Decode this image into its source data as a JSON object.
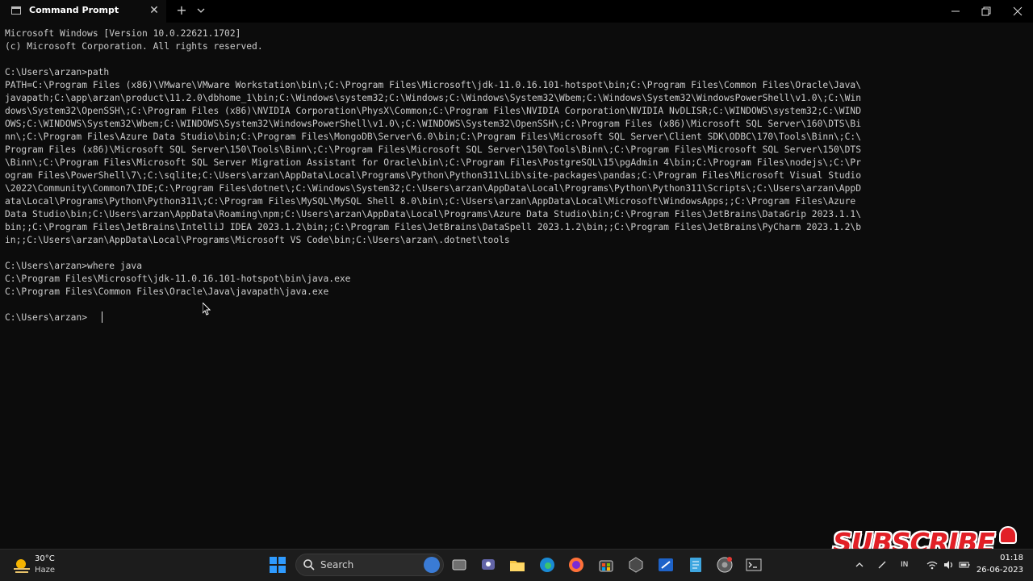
{
  "window": {
    "tab_title": "Command Prompt",
    "tab_close_glyph": "✕",
    "new_tab_glyph": "+"
  },
  "terminal": {
    "lines": [
      "Microsoft Windows [Version 10.0.22621.1702]",
      "(c) Microsoft Corporation. All rights reserved.",
      "",
      "C:\\Users\\arzan>path",
      "PATH=C:\\Program Files (x86)\\VMware\\VMware Workstation\\bin\\;C:\\Program Files\\Microsoft\\jdk-11.0.16.101-hotspot\\bin;C:\\Program Files\\Common Files\\Oracle\\Java\\",
      "javapath;C:\\app\\arzan\\product\\11.2.0\\dbhome_1\\bin;C:\\Windows\\system32;C:\\Windows;C:\\Windows\\System32\\Wbem;C:\\Windows\\System32\\WindowsPowerShell\\v1.0\\;C:\\Win",
      "dows\\System32\\OpenSSH\\;C:\\Program Files (x86)\\NVIDIA Corporation\\PhysX\\Common;C:\\Program Files\\NVIDIA Corporation\\NVIDIA NvDLISR;C:\\WINDOWS\\system32;C:\\WIND",
      "OWS;C:\\WINDOWS\\System32\\Wbem;C:\\WINDOWS\\System32\\WindowsPowerShell\\v1.0\\;C:\\WINDOWS\\System32\\OpenSSH\\;C:\\Program Files (x86)\\Microsoft SQL Server\\160\\DTS\\Bi",
      "nn\\;C:\\Program Files\\Azure Data Studio\\bin;C:\\Program Files\\MongoDB\\Server\\6.0\\bin;C:\\Program Files\\Microsoft SQL Server\\Client SDK\\ODBC\\170\\Tools\\Binn\\;C:\\",
      "Program Files (x86)\\Microsoft SQL Server\\150\\Tools\\Binn\\;C:\\Program Files\\Microsoft SQL Server\\150\\Tools\\Binn\\;C:\\Program Files\\Microsoft SQL Server\\150\\DTS",
      "\\Binn\\;C:\\Program Files\\Microsoft SQL Server Migration Assistant for Oracle\\bin\\;C:\\Program Files\\PostgreSQL\\15\\pgAdmin 4\\bin;C:\\Program Files\\nodejs\\;C:\\Pr",
      "ogram Files\\PowerShell\\7\\;C:\\sqlite;C:\\Users\\arzan\\AppData\\Local\\Programs\\Python\\Python311\\Lib\\site-packages\\pandas;C:\\Program Files\\Microsoft Visual Studio",
      "\\2022\\Community\\Common7\\IDE;C:\\Program Files\\dotnet\\;C:\\Windows\\System32;C:\\Users\\arzan\\AppData\\Local\\Programs\\Python\\Python311\\Scripts\\;C:\\Users\\arzan\\AppD",
      "ata\\Local\\Programs\\Python\\Python311\\;C:\\Program Files\\MySQL\\MySQL Shell 8.0\\bin\\;C:\\Users\\arzan\\AppData\\Local\\Microsoft\\WindowsApps;;C:\\Program Files\\Azure",
      "Data Studio\\bin;C:\\Users\\arzan\\AppData\\Roaming\\npm;C:\\Users\\arzan\\AppData\\Local\\Programs\\Azure Data Studio\\bin;C:\\Program Files\\JetBrains\\DataGrip 2023.1.1\\",
      "bin;;C:\\Program Files\\JetBrains\\IntelliJ IDEA 2023.1.2\\bin;;C:\\Program Files\\JetBrains\\DataSpell 2023.1.2\\bin;;C:\\Program Files\\JetBrains\\PyCharm 2023.1.2\\b",
      "in;;C:\\Users\\arzan\\AppData\\Local\\Programs\\Microsoft VS Code\\bin;C:\\Users\\arzan\\.dotnet\\tools",
      "",
      "C:\\Users\\arzan>where java",
      "C:\\Program Files\\Microsoft\\jdk-11.0.16.101-hotspot\\bin\\java.exe",
      "C:\\Program Files\\Common Files\\Oracle\\Java\\javapath\\java.exe",
      "",
      "C:\\Users\\arzan>"
    ]
  },
  "overlay": {
    "subscribe_text": "SUBSCRIBE"
  },
  "taskbar": {
    "weather_temp": "30°C",
    "weather_condition": "Haze",
    "search_label": "Search",
    "language": "IN",
    "clock_time": "01:18",
    "clock_date": "26-06-2023",
    "icons": [
      "start-icon",
      "search-icon",
      "bing-icon",
      "task-view-icon",
      "teams-icon",
      "file-explorer-icon",
      "edge-icon",
      "firefox-icon",
      "store-icon",
      "terminal-app-icon",
      "sublime-icon",
      "notepad-icon",
      "chrome-icon",
      "command-prompt-icon"
    ]
  }
}
